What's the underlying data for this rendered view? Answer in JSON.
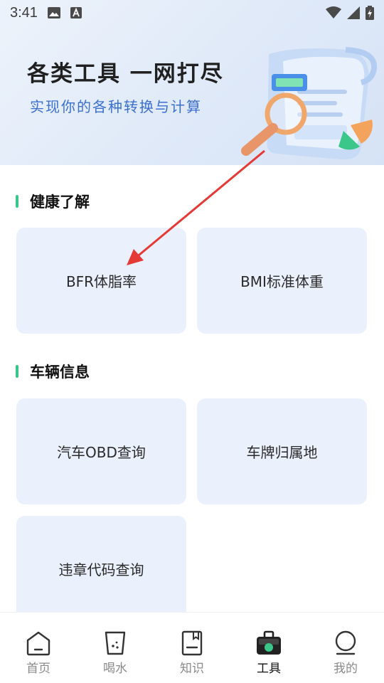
{
  "status_bar": {
    "time": "3:41",
    "left_icons": [
      "image-icon",
      "a-badge-icon"
    ],
    "right_icons": [
      "wifi-icon",
      "signal-icon",
      "battery-icon"
    ]
  },
  "banner": {
    "title": "各类工具 一网打尽",
    "subtitle": "实现你的各种转换与计算",
    "art_icon": "magnifier-document-illustration",
    "colors": {
      "title": "#202020",
      "subtitle": "#3a6fd0"
    }
  },
  "sections": [
    {
      "title": "健康了解",
      "tiles": [
        {
          "label": "BFR体脂率"
        },
        {
          "label": "BMI标准体重"
        }
      ]
    },
    {
      "title": "车辆信息",
      "tiles": [
        {
          "label": "汽车OBD查询"
        },
        {
          "label": "车牌归属地"
        },
        {
          "label": "违章代码查询"
        }
      ]
    }
  ],
  "bottom_nav": {
    "active_index": 3,
    "items": [
      {
        "label": "首页",
        "icon": "home-icon"
      },
      {
        "label": "喝水",
        "icon": "water-cup-icon"
      },
      {
        "label": "知识",
        "icon": "book-icon"
      },
      {
        "label": "工具",
        "icon": "toolbox-icon"
      },
      {
        "label": "我的",
        "icon": "profile-icon"
      }
    ]
  },
  "colors": {
    "accent": "#3cc78a",
    "tile_bg": "#ebf1fc",
    "annotation_arrow": "#e53935"
  }
}
